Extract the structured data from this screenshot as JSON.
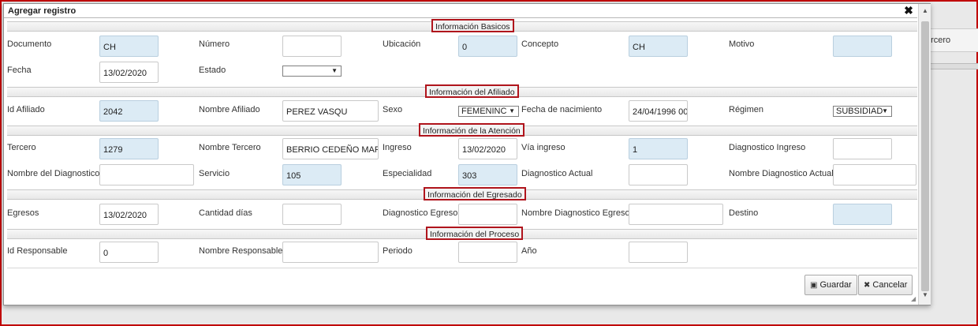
{
  "background": {
    "tab_label": "ercero"
  },
  "dialog": {
    "title": "Agregar registro",
    "close_glyph": "✖",
    "scroll_up": "▲",
    "scroll_down": "▼",
    "resize_glyph": "◢"
  },
  "sections": {
    "basicos": "Información Basicos",
    "afiliado": "Información del Afiliado",
    "atencion": "Información de la Atención",
    "egresado": "Información del Egresado",
    "proceso": "Información del Proceso"
  },
  "basicos": {
    "documento": {
      "label": "Documento",
      "value": "CH"
    },
    "numero": {
      "label": "Número",
      "value": ""
    },
    "ubicacion": {
      "label": "Ubicación",
      "value": "0"
    },
    "concepto": {
      "label": "Concepto",
      "value": "CH"
    },
    "motivo": {
      "label": "Motivo",
      "value": ""
    },
    "fecha": {
      "label": "Fecha",
      "value": "13/02/2020"
    },
    "estado": {
      "label": "Estado",
      "value": ""
    }
  },
  "afiliado": {
    "id": {
      "label": "Id Afiliado",
      "value": "2042"
    },
    "nombre": {
      "label": "Nombre Afiliado",
      "value": "PEREZ           VASQU"
    },
    "sexo": {
      "label": "Sexo",
      "value": "FEMENINC"
    },
    "nacimiento": {
      "label": "Fecha de nacimiento",
      "value": "24/04/1996 00"
    },
    "regimen": {
      "label": "Régimen",
      "value": "SUBSIDIAD"
    }
  },
  "atencion": {
    "tercero": {
      "label": "Tercero",
      "value": "1279"
    },
    "nombre_tercero": {
      "label": "Nombre Tercero",
      "value": "BERRIO CEDEÑO MARI"
    },
    "ingreso": {
      "label": "Ingreso",
      "value": "13/02/2020"
    },
    "via_ingreso": {
      "label": "Vía ingreso",
      "value": "1"
    },
    "diag_ingreso": {
      "label": "Diagnostico Ingreso",
      "value": ""
    },
    "nombre_diag": {
      "label": "Nombre del Diagnostico",
      "value": ""
    },
    "servicio": {
      "label": "Servicio",
      "value": "105"
    },
    "especialidad": {
      "label": "Especialidad",
      "value": "303"
    },
    "diag_actual": {
      "label": "Diagnostico Actual",
      "value": ""
    },
    "nombre_diag_actual": {
      "label": "Nombre Diagnostico Actual",
      "value": ""
    }
  },
  "egresado": {
    "egresos": {
      "label": "Egresos",
      "value": "13/02/2020"
    },
    "cantidad_dias": {
      "label": "Cantidad días",
      "value": ""
    },
    "diag_egreso": {
      "label": "Diagnostico Egreso",
      "value": ""
    },
    "nombre_diag_egreso": {
      "label": "Nombre Diagnostico Egreso",
      "value": ""
    },
    "destino": {
      "label": "Destino",
      "value": ""
    }
  },
  "proceso": {
    "id_responsable": {
      "label": "Id Responsable",
      "value": "0"
    },
    "nombre_responsable": {
      "label": "Nombre Responsable",
      "value": ""
    },
    "periodo": {
      "label": "Periodo",
      "value": ""
    },
    "anio": {
      "label": "Año",
      "value": ""
    }
  },
  "buttons": {
    "save": {
      "icon": "▣",
      "label": "Guardar"
    },
    "cancel": {
      "icon": "✖",
      "label": "Cancelar"
    }
  },
  "select_arrow": "▼"
}
